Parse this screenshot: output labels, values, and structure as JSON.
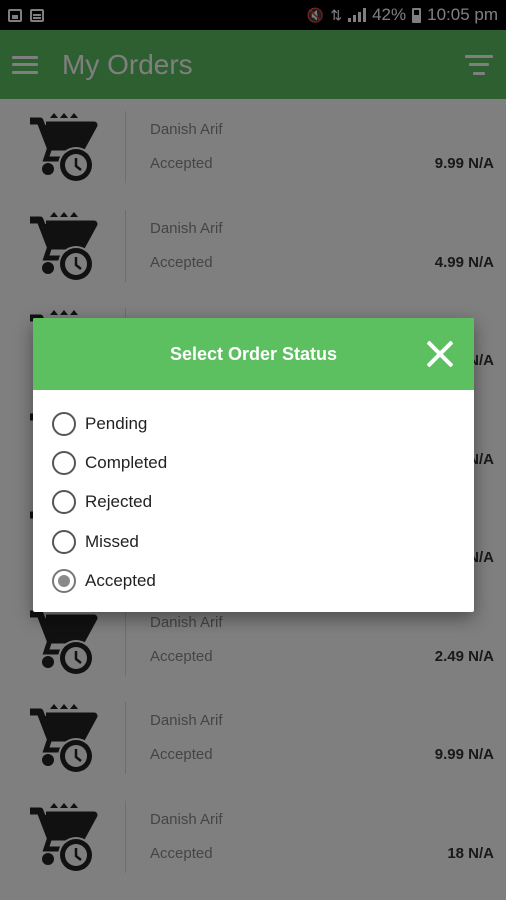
{
  "status_bar": {
    "battery": "42%",
    "time": "10:05 pm",
    "icons": [
      "gallery-icon",
      "message-icon",
      "mute-icon",
      "data-icon",
      "signal-icon",
      "battery-icon"
    ]
  },
  "app_bar": {
    "title": "My Orders",
    "menu_icon": "hamburger-icon",
    "filter_icon": "filter-icon",
    "color": "#5cbf60"
  },
  "orders": [
    {
      "name": "Danish Arif",
      "status": "Accepted",
      "amount": "9.99 N/A"
    },
    {
      "name": "Danish Arif",
      "status": "Accepted",
      "amount": "4.99 N/A"
    },
    {
      "name": "",
      "status": "",
      "amount": "N/A"
    },
    {
      "name": "",
      "status": "",
      "amount": "N/A"
    },
    {
      "name": "",
      "status": "",
      "amount": "N/A"
    },
    {
      "name": "Danish Arif",
      "status": "Accepted",
      "amount": "2.49 N/A"
    },
    {
      "name": "Danish Arif",
      "status": "Accepted",
      "amount": "9.99 N/A"
    },
    {
      "name": "Danish Arif",
      "status": "Accepted",
      "amount": "18 N/A"
    }
  ],
  "dialog": {
    "title": "Select Order Status",
    "close_icon": "close-icon",
    "options": [
      {
        "label": "Pending",
        "selected": false
      },
      {
        "label": "Completed",
        "selected": false
      },
      {
        "label": "Rejected",
        "selected": false
      },
      {
        "label": "Missed",
        "selected": false
      },
      {
        "label": "Accepted",
        "selected": true
      }
    ]
  }
}
